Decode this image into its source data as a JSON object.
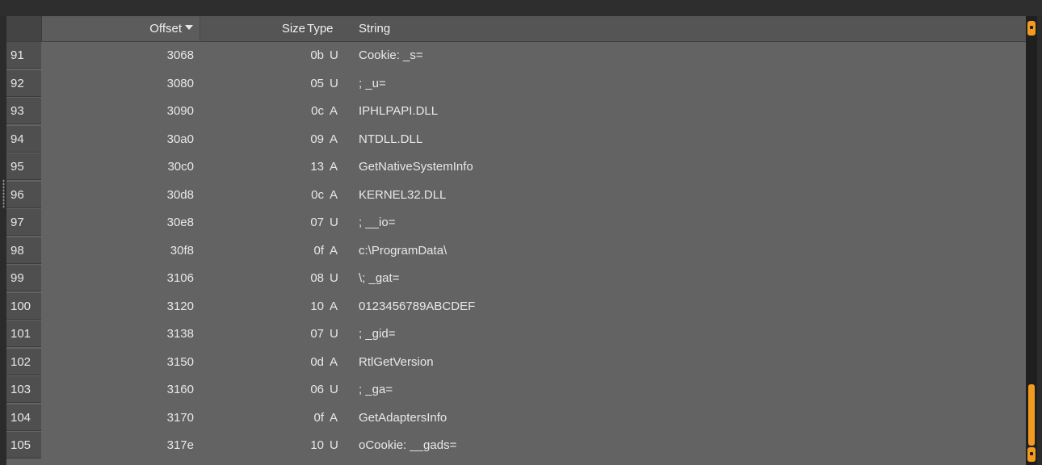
{
  "header": {
    "offset_label": "Offset",
    "size_label": "Size",
    "type_label": "Type",
    "string_label": "String"
  },
  "rows": [
    {
      "index": "91",
      "offset": "3068",
      "size": "0b",
      "type": "U",
      "string": "Cookie: _s="
    },
    {
      "index": "92",
      "offset": "3080",
      "size": "05",
      "type": "U",
      "string": "; _u="
    },
    {
      "index": "93",
      "offset": "3090",
      "size": "0c",
      "type": "A",
      "string": "IPHLPAPI.DLL"
    },
    {
      "index": "94",
      "offset": "30a0",
      "size": "09",
      "type": "A",
      "string": "NTDLL.DLL"
    },
    {
      "index": "95",
      "offset": "30c0",
      "size": "13",
      "type": "A",
      "string": "GetNativeSystemInfo"
    },
    {
      "index": "96",
      "offset": "30d8",
      "size": "0c",
      "type": "A",
      "string": "KERNEL32.DLL"
    },
    {
      "index": "97",
      "offset": "30e8",
      "size": "07",
      "type": "U",
      "string": "; __io="
    },
    {
      "index": "98",
      "offset": "30f8",
      "size": "0f",
      "type": "A",
      "string": "c:\\ProgramData\\"
    },
    {
      "index": "99",
      "offset": "3106",
      "size": "08",
      "type": "U",
      "string": "\\; _gat="
    },
    {
      "index": "100",
      "offset": "3120",
      "size": "10",
      "type": "A",
      "string": "0123456789ABCDEF"
    },
    {
      "index": "101",
      "offset": "3138",
      "size": "07",
      "type": "U",
      "string": "; _gid="
    },
    {
      "index": "102",
      "offset": "3150",
      "size": "0d",
      "type": "A",
      "string": "RtlGetVersion"
    },
    {
      "index": "103",
      "offset": "3160",
      "size": "06",
      "type": "U",
      "string": "; _ga="
    },
    {
      "index": "104",
      "offset": "3170",
      "size": "0f",
      "type": "A",
      "string": "GetAdaptersInfo"
    },
    {
      "index": "105",
      "offset": "317e",
      "size": "10",
      "type": "U",
      "string": "oCookie: __gads="
    }
  ],
  "colors": {
    "accent": "#f29b1f",
    "table_background": "#636363",
    "header_background": "#555555"
  }
}
